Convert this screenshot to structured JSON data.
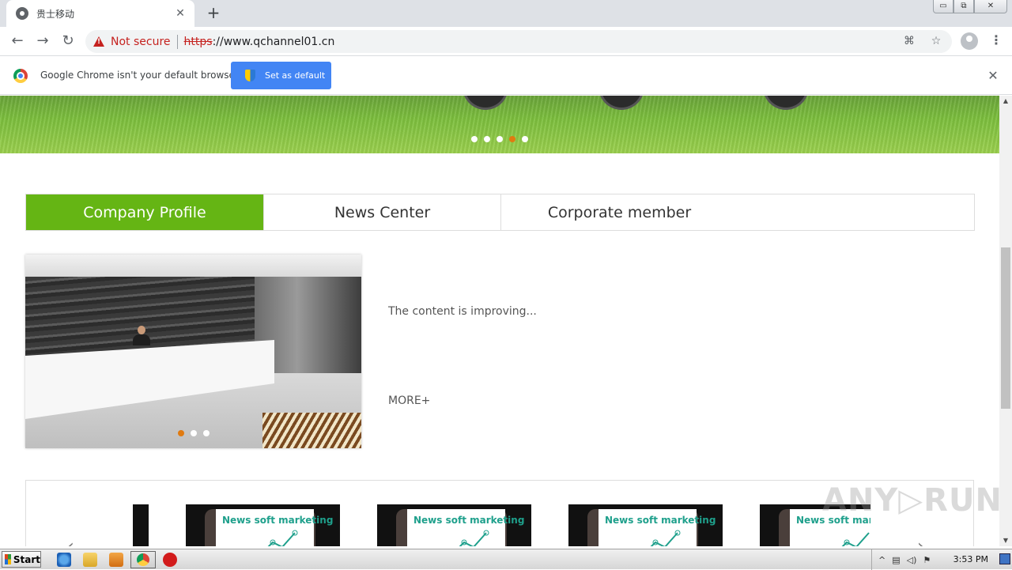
{
  "browser": {
    "tab": {
      "title": "贵士移动",
      "close": "✕"
    },
    "newtab": "+",
    "window_controls": {
      "minimize": "▭",
      "restore": "⧉",
      "close": "✕"
    },
    "nav": {
      "back": "←",
      "forward": "→",
      "reload": "↻"
    },
    "address": {
      "security_label": "Not secure",
      "scheme": "https",
      "host": "://www.qchannel01.cn"
    },
    "omni_icons": {
      "translate": "⌘",
      "bookmark": "☆"
    },
    "menu": "⋮"
  },
  "infobar": {
    "message": "Google Chrome isn't your default browser",
    "button": "Set as default",
    "close": "✕"
  },
  "page": {
    "banner": {
      "slide_count": 5,
      "active_slide": 4
    },
    "tabs": [
      "Company Profile",
      "News Center",
      "Corporate member"
    ],
    "active_tab": 0,
    "profile": {
      "text": "The content is improving...",
      "more": "MORE+",
      "slide_count": 3,
      "active_slide": 1
    },
    "carousel": {
      "prev": "‹",
      "next": "›",
      "cards": [
        "News soft marketing",
        "News soft marketing",
        "News soft marketing",
        "News soft marketing"
      ]
    },
    "watermark": "ANY▷RUN"
  },
  "scrollbar": {
    "up": "▲",
    "down": "▼"
  },
  "taskbar": {
    "start": "Start",
    "tray_expand": "^",
    "time": "3:53 PM"
  },
  "colors": {
    "accent_green": "#65b514",
    "chrome_blue": "#4285f4",
    "warning_red": "#c5221f",
    "dot_active": "#e07a10"
  }
}
